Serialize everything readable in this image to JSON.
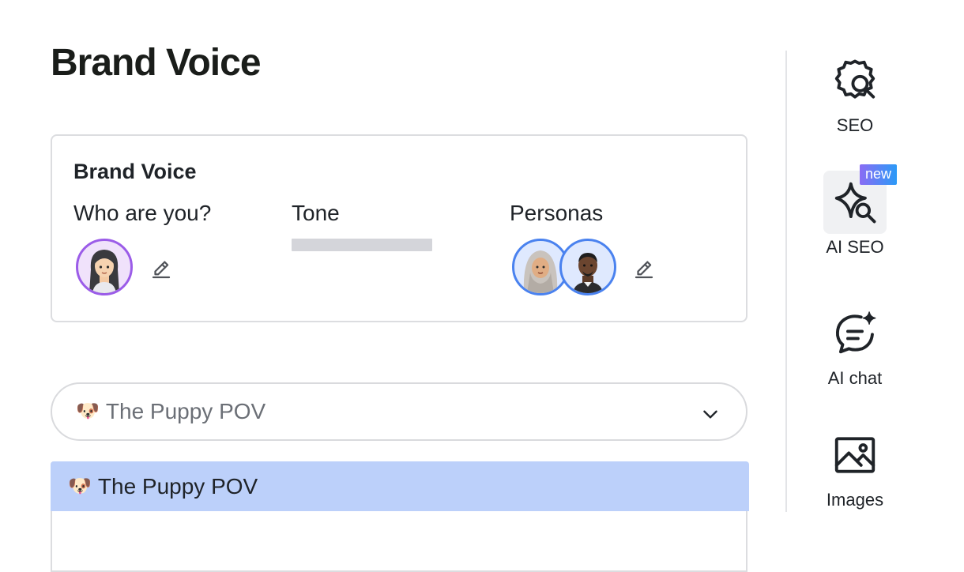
{
  "page": {
    "title": "Brand Voice"
  },
  "brand_voice_card": {
    "title": "Brand Voice",
    "who_label": "Who are you?",
    "tone_label": "Tone",
    "personas_label": "Personas"
  },
  "voice_select": {
    "emoji": "🐶",
    "value": "The Puppy POV"
  },
  "dropdown": {
    "options": [
      {
        "emoji": "🐶",
        "label": "The Puppy POV"
      }
    ]
  },
  "sidebar_tools": [
    {
      "label": "SEO",
      "icon": "gear-search-icon"
    },
    {
      "label": "AI SEO",
      "icon": "sparkle-search-icon",
      "badge": "new"
    },
    {
      "label": "AI chat",
      "icon": "chat-sparkle-icon"
    },
    {
      "label": "Images",
      "icon": "image-icon"
    }
  ],
  "colors": {
    "accent_purple": "#9b5ce8",
    "accent_blue": "#4a82ef",
    "selected_option_bg": "#bcd0fa",
    "badge_bg": "#2b8ff7"
  }
}
